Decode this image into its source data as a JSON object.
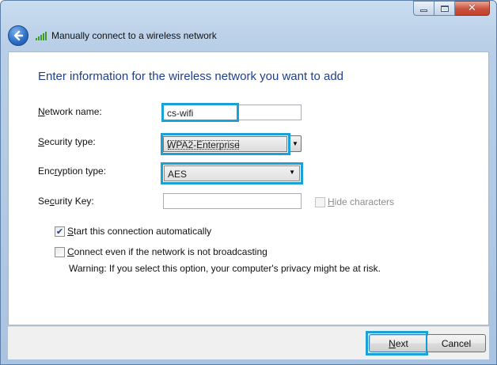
{
  "window": {
    "title": "Manually connect to a wireless network",
    "caption_buttons": [
      "minimize-icon",
      "maximize-icon",
      "close-icon"
    ],
    "close_glyph": "✕"
  },
  "main": {
    "heading": "Enter information for the wireless network you want to add",
    "network_name": {
      "label_pre": "",
      "label_key": "N",
      "label_post": "etwork name:",
      "value": "cs-wifi"
    },
    "security_type": {
      "label_pre": "",
      "label_key": "S",
      "label_post": "ecurity type:",
      "value": "WPA2-Enterprise"
    },
    "encryption_type": {
      "label_pre": "Enc",
      "label_key": "r",
      "label_post": "yption type:",
      "value": "AES"
    },
    "security_key": {
      "label_pre": "Se",
      "label_key": "c",
      "label_post": "urity Key:",
      "value": ""
    },
    "hide_characters": {
      "label_pre": "",
      "label_key": "H",
      "label_post": "ide characters",
      "checked": false,
      "enabled": false
    },
    "start_auto": {
      "label_pre": "",
      "label_key": "S",
      "label_post": "tart this connection automatically",
      "checked": true
    },
    "connect_hidden": {
      "label_pre": "",
      "label_key": "C",
      "label_post": "onnect even if the network is not broadcasting",
      "checked": false
    },
    "warning": "Warning: If you select this option, your computer's privacy might be at risk."
  },
  "footer": {
    "next_label": "Next",
    "next_key": "N",
    "next_rest": "ext",
    "cancel_label": "Cancel"
  },
  "colors": {
    "highlight": "#1aa1d8",
    "heading": "#1e3f8f"
  }
}
